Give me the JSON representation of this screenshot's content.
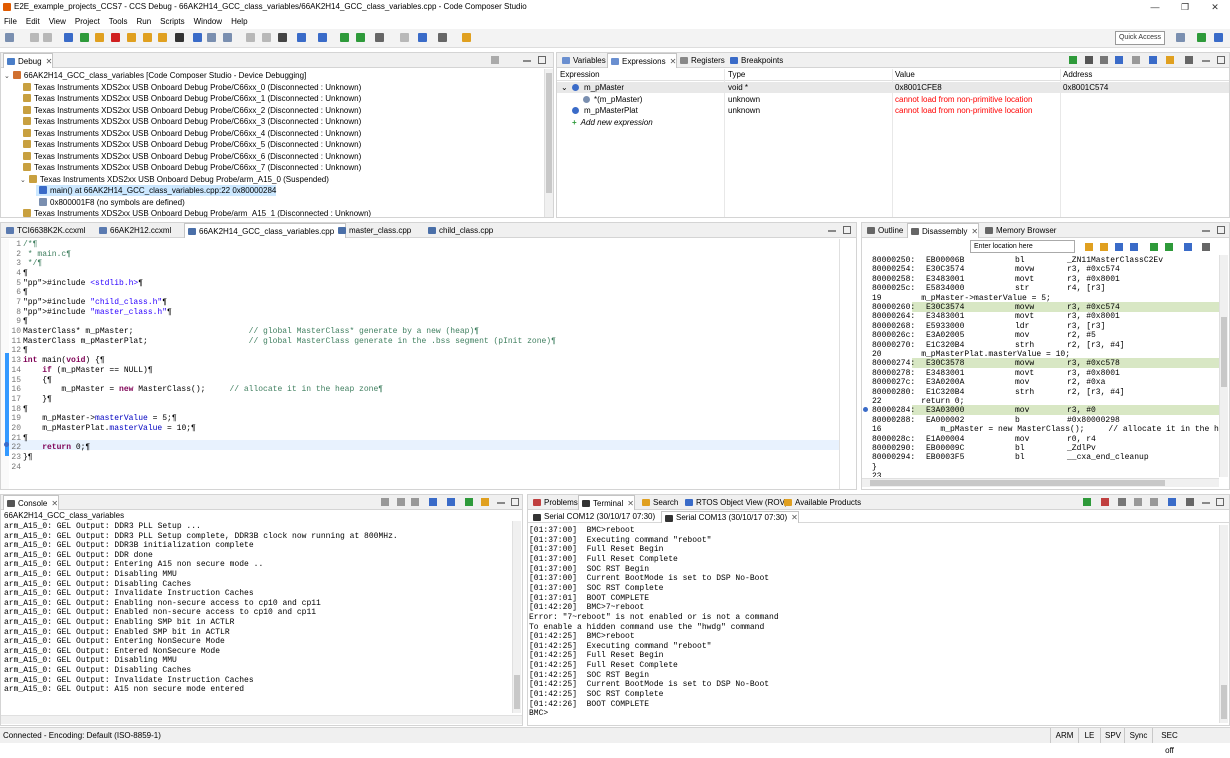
{
  "window": {
    "title": "E2E_example_projects_CCS7 - CCS Debug - 66AK2H14_GCC_class_variables/66AK2H14_GCC_class_variables.cpp - Code Composer Studio",
    "minimize": "—",
    "maximize": "❐",
    "close": "✕"
  },
  "menu": [
    "File",
    "Edit",
    "View",
    "Project",
    "Tools",
    "Run",
    "Scripts",
    "Window",
    "Help"
  ],
  "toolbar": {
    "quick_access": "Quick Access"
  },
  "debug": {
    "tab": "Debug",
    "items": [
      {
        "text": "66AK2H14_GCC_class_variables [Code Composer Studio - Device Debugging]",
        "indent": 0
      },
      {
        "text": "Texas Instruments XDS2xx USB Onboard Debug Probe/C66xx_0 (Disconnected : Unknown)",
        "indent": 1
      },
      {
        "text": "Texas Instruments XDS2xx USB Onboard Debug Probe/C66xx_1 (Disconnected : Unknown)",
        "indent": 1
      },
      {
        "text": "Texas Instruments XDS2xx USB Onboard Debug Probe/C66xx_2 (Disconnected : Unknown)",
        "indent": 1
      },
      {
        "text": "Texas Instruments XDS2xx USB Onboard Debug Probe/C66xx_3 (Disconnected : Unknown)",
        "indent": 1
      },
      {
        "text": "Texas Instruments XDS2xx USB Onboard Debug Probe/C66xx_4 (Disconnected : Unknown)",
        "indent": 1
      },
      {
        "text": "Texas Instruments XDS2xx USB Onboard Debug Probe/C66xx_5 (Disconnected : Unknown)",
        "indent": 1
      },
      {
        "text": "Texas Instruments XDS2xx USB Onboard Debug Probe/C66xx_6 (Disconnected : Unknown)",
        "indent": 1
      },
      {
        "text": "Texas Instruments XDS2xx USB Onboard Debug Probe/C66xx_7 (Disconnected : Unknown)",
        "indent": 1
      },
      {
        "text": "Texas Instruments XDS2xx USB Onboard Debug Probe/arm_A15_0 (Suspended)",
        "indent": 1
      },
      {
        "text": "main() at 66AK2H14_GCC_class_variables.cpp:22 0x80000284",
        "indent": 2
      },
      {
        "text": "0x800001F8  (no symbols are defined)",
        "indent": 2
      },
      {
        "text": "Texas Instruments XDS2xx USB Onboard Debug Probe/arm_A15_1 (Disconnected : Unknown)",
        "indent": 1
      }
    ]
  },
  "views_tabs": [
    "Variables",
    "Expressions",
    "Registers",
    "Breakpoints"
  ],
  "expressions": {
    "headers": [
      "Expression",
      "Type",
      "Value",
      "Address"
    ],
    "rows": [
      {
        "expr": "m_pMaster",
        "type": "void *",
        "value": "0x8001CFE8",
        "addr": "0x8001C574",
        "indent": 0
      },
      {
        "expr": "*(m_pMaster)",
        "type": "unknown",
        "value": "cannot load from non-primitive location",
        "addr": "",
        "indent": 1
      },
      {
        "expr": "m_pMasterPlat",
        "type": "unknown",
        "value": "cannot load from non-primitive location",
        "addr": "",
        "indent": 0
      }
    ],
    "add_new": "Add new expression"
  },
  "editor": {
    "tabs": [
      "TCI6638K2K.ccxml",
      "66AK2H12.ccxml",
      "66AK2H14_GCC_class_variables.cpp",
      "master_class.cpp",
      "child_class.cpp"
    ],
    "lines": [
      "/*¶",
      " * main.c¶",
      " */¶",
      "¶",
      "#include <stdlib.h>¶",
      "¶",
      "#include \"child_class.h\"¶",
      "#include \"master_class.h\"¶",
      "¶",
      "MasterClass* m_pMaster;                        // global MasterClass* generate by a new (heap)¶",
      "MasterClass m_pMasterPlat;                     // global MasterClass generate in the .bss segment (pInit zone)¶",
      "¶",
      "int main(void) {¶",
      "    if (m_pMaster == NULL)¶",
      "    {¶",
      "        m_pMaster = new MasterClass();     // allocate it in the heap zone¶",
      "    }¶",
      "¶",
      "    m_pMaster->masterValue = 5;¶",
      "    m_pMasterPlat.masterValue = 10;¶",
      "¶",
      "    return 0;¶",
      "}¶",
      ""
    ]
  },
  "outline_tabs": [
    "Outline",
    "Disassembly",
    "Memory Browser"
  ],
  "disasm": {
    "location_placeholder": "Enter location here",
    "lines": [
      {
        "addr": "80000250:",
        "op": "EB00006B",
        "mn": "bl",
        "arg": "_ZN11MasterClassC2Ev",
        "hl": false,
        "src": false
      },
      {
        "addr": "80000254:",
        "op": "E30C3574",
        "mn": "movw",
        "arg": "r3, #0xc574",
        "hl": false,
        "src": false
      },
      {
        "addr": "80000258:",
        "op": "E3483001",
        "mn": "movt",
        "arg": "r3, #0x8001",
        "hl": false,
        "src": false
      },
      {
        "addr": "8000025c:",
        "op": "E5834000",
        "mn": "str",
        "arg": "r4, [r3]",
        "hl": false,
        "src": false
      },
      {
        "addr": "19",
        "op": "",
        "mn": "",
        "arg": "    m_pMaster->masterValue = 5;",
        "hl": false,
        "src": true
      },
      {
        "addr": "80000260:",
        "op": "E30C3574",
        "mn": "movw",
        "arg": "r3, #0xc574",
        "hl": true,
        "src": false
      },
      {
        "addr": "80000264:",
        "op": "E3483001",
        "mn": "movt",
        "arg": "r3, #0x8001",
        "hl": false,
        "src": false
      },
      {
        "addr": "80000268:",
        "op": "E5933000",
        "mn": "ldr",
        "arg": "r3, [r3]",
        "hl": false,
        "src": false
      },
      {
        "addr": "8000026c:",
        "op": "E3A02005",
        "mn": "mov",
        "arg": "r2, #5",
        "hl": false,
        "src": false
      },
      {
        "addr": "80000270:",
        "op": "E1C320B4",
        "mn": "strh",
        "arg": "r2, [r3, #4]",
        "hl": false,
        "src": false
      },
      {
        "addr": "20",
        "op": "",
        "mn": "",
        "arg": "    m_pMasterPlat.masterValue = 10;",
        "hl": false,
        "src": true
      },
      {
        "addr": "80000274:",
        "op": "E30C3578",
        "mn": "movw",
        "arg": "r3, #0xc578",
        "hl": true,
        "src": false
      },
      {
        "addr": "80000278:",
        "op": "E3483001",
        "mn": "movt",
        "arg": "r3, #0x8001",
        "hl": false,
        "src": false
      },
      {
        "addr": "8000027c:",
        "op": "E3A0200A",
        "mn": "mov",
        "arg": "r2, #0xa",
        "hl": false,
        "src": false
      },
      {
        "addr": "80000280:",
        "op": "E1C320B4",
        "mn": "strh",
        "arg": "r2, [r3, #4]",
        "hl": false,
        "src": false
      },
      {
        "addr": "22",
        "op": "",
        "mn": "",
        "arg": "    return 0;",
        "hl": false,
        "src": true
      },
      {
        "addr": "80000284:",
        "op": "E3A03000",
        "mn": "mov",
        "arg": "r3, #0",
        "hl": true,
        "src": false
      },
      {
        "addr": "80000288:",
        "op": "EA000002",
        "mn": "b",
        "arg": "#0x80000298",
        "hl": false,
        "src": false
      },
      {
        "addr": "16",
        "op": "",
        "mn": "",
        "arg": "        m_pMaster = new MasterClass();     // allocate it in the h",
        "hl": false,
        "src": true
      },
      {
        "addr": "8000028c:",
        "op": "E1A00004",
        "mn": "mov",
        "arg": "r0, r4",
        "hl": false,
        "src": false
      },
      {
        "addr": "80000290:",
        "op": "EB00009C",
        "mn": "bl",
        "arg": "_ZdlPv",
        "hl": false,
        "src": false
      },
      {
        "addr": "80000294:",
        "op": "EB0003F5",
        "mn": "bl",
        "arg": "__cxa_end_cleanup",
        "hl": false,
        "src": false
      },
      {
        "addr": "}",
        "op": "",
        "mn": "",
        "arg": "",
        "hl": false,
        "src": true
      },
      {
        "addr": "23",
        "op": "",
        "mn": "",
        "arg": "",
        "hl": false,
        "src": true
      }
    ]
  },
  "console": {
    "tab": "Console",
    "context": "66AK2H14_GCC_class_variables",
    "lines": [
      "arm_A15_0: GEL Output: DDR3 PLL Setup ...",
      "arm_A15_0: GEL Output: DDR3 PLL Setup complete, DDR3B clock now running at 800MHz.",
      "arm_A15_0: GEL Output: DDR3B initialization complete",
      "arm_A15_0: GEL Output: DDR done",
      "arm_A15_0: GEL Output: Entering A15 non secure mode ..",
      "arm_A15_0: GEL Output: Disabling MMU",
      "arm_A15_0: GEL Output: Disabling Caches",
      "arm_A15_0: GEL Output: Invalidate Instruction Caches",
      "arm_A15_0: GEL Output: Enabling non-secure access to cp10 and cp11",
      "arm_A15_0: GEL Output: Enabled non-secure access to cp10 and cp11",
      "arm_A15_0: GEL Output: Enabling SMP bit in ACTLR",
      "arm_A15_0: GEL Output: Enabled SMP bit in ACTLR",
      "arm_A15_0: GEL Output: Entering NonSecure Mode",
      "arm_A15_0: GEL Output: Entered NonSecure Mode",
      "arm_A15_0: GEL Output: Disabling MMU",
      "arm_A15_0: GEL Output: Disabling Caches",
      "arm_A15_0: GEL Output: Invalidate Instruction Caches",
      "arm_A15_0: GEL Output: A15 non secure mode entered"
    ]
  },
  "bottom_tabs": [
    "Problems",
    "Terminal",
    "Search",
    "RTOS Object View (ROV)",
    "Available Products"
  ],
  "terminal": {
    "tabs": [
      "Serial COM12 (30/10/17 07:30)",
      "Serial COM13 (30/10/17 07:30)"
    ],
    "lines": [
      "[01:37:00]  BMC>reboot",
      "[01:37:00]  Executing command \"reboot\"",
      "[01:37:00]  Full Reset Begin",
      "[01:37:00]  Full Reset Complete",
      "[01:37:00]  SOC RST Begin",
      "[01:37:00]  Current BootMode is set to DSP No-Boot",
      "[01:37:00]  SOC RST Complete",
      "[01:37:01]  BOOT COMPLETE",
      "[01:42:20]  BMC>7~reboot",
      "Error: \"7~reboot\" is not enabled or is not a command",
      "To enable a hidden command use the \"hwdg\" command",
      "[01:42:25]  BMC>reboot",
      "[01:42:25]  Executing command \"reboot\"",
      "[01:42:25]  Full Reset Begin",
      "[01:42:25]  Full Reset Complete",
      "[01:42:25]  SOC RST Begin",
      "[01:42:25]  Current BootMode is set to DSP No-Boot",
      "[01:42:25]  SOC RST Complete",
      "[01:42:26]  BOOT COMPLETE",
      "BMC>"
    ]
  },
  "status": {
    "left": "Connected - Encoding: Default (ISO-8859-1)",
    "cells": [
      "ARM",
      "LE",
      "SPV",
      "Sync",
      "SEC off"
    ]
  },
  "colors": {
    "current_line": "#e8f2fe",
    "disasm_hl": "#d8e7c4",
    "error": "#ff0000",
    "accent": "#3399ff"
  }
}
